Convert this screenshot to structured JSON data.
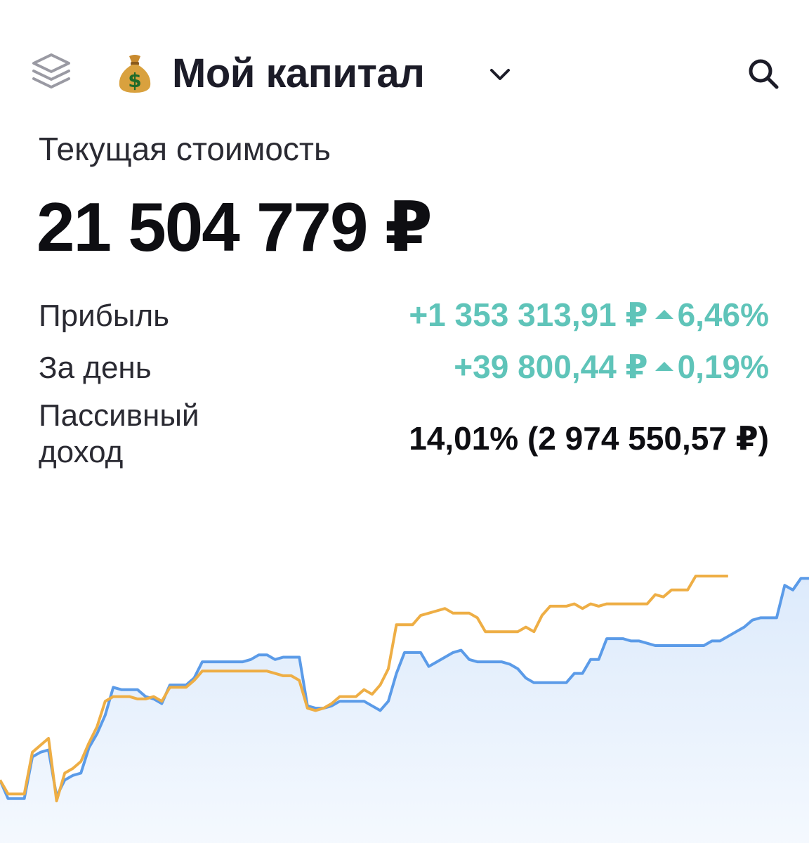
{
  "header": {
    "title": "Мой капитал",
    "layers_icon": "layers-icon",
    "portfolio_icon": "money-bag-icon",
    "dropdown_icon": "chevron-down-icon",
    "search_icon": "search-icon"
  },
  "summary": {
    "current_value_label": "Текущая стоимость",
    "current_value": "21 504 779 ₽",
    "profit_label": "Прибыль",
    "profit_value": "+1 353 313,91 ₽",
    "profit_percent": "6,46%",
    "day_label": "За день",
    "day_value": "+39 800,44 ₽",
    "day_percent": "0,19%",
    "passive_label_line1": "Пассивный",
    "passive_label_line2": "доход",
    "passive_value": "14,01% (2 974 550,57 ₽)"
  },
  "colors": {
    "positive": "#5fc4b9",
    "portfolio_line": "#5b9be8",
    "benchmark_line": "#eeae45",
    "area_fill": "#e4effd"
  },
  "chart_data": {
    "type": "line",
    "title": "",
    "xlabel": "",
    "ylabel": "",
    "grid": false,
    "legend": "none",
    "x": [
      0,
      1,
      2,
      3,
      4,
      5,
      6,
      7,
      8,
      9,
      10,
      11,
      12,
      13,
      14,
      15,
      16,
      17,
      18,
      19,
      20,
      21,
      22,
      23,
      24,
      25,
      26,
      27,
      28,
      29,
      30,
      31,
      32,
      33,
      34,
      35,
      36,
      37,
      38,
      39,
      40,
      41,
      42,
      43,
      44,
      45,
      46,
      47,
      48,
      49,
      50,
      51,
      52,
      53,
      54,
      55,
      56,
      57,
      58,
      59,
      60,
      61,
      62,
      63,
      64,
      65,
      66,
      67,
      68,
      69,
      70,
      71,
      72,
      73,
      74,
      75,
      76,
      77,
      78,
      79,
      80,
      81,
      82,
      83,
      84,
      85,
      86,
      87,
      88,
      89,
      90,
      91,
      92,
      93,
      94,
      95,
      96,
      97,
      98,
      99,
      100
    ],
    "series": [
      {
        "values": [
          12,
          4,
          4,
          4,
          22,
          24,
          25,
          5,
          12,
          14,
          15,
          26,
          32,
          40,
          52,
          51,
          51,
          51,
          48,
          47,
          45,
          53,
          53,
          53,
          56,
          63,
          63,
          63,
          63,
          63,
          63,
          64,
          66,
          66,
          64,
          65,
          65,
          65,
          44,
          43,
          43,
          44,
          46,
          46,
          46,
          46,
          44,
          42,
          46,
          58,
          67,
          67,
          67,
          61,
          63,
          65,
          67,
          68,
          64,
          63,
          63,
          63,
          63,
          62,
          60,
          56,
          54,
          54,
          54,
          54,
          54,
          58,
          58,
          64,
          64,
          73,
          73,
          73,
          72,
          72,
          71,
          70,
          70,
          70,
          70,
          70,
          70,
          70,
          72,
          72,
          74,
          76,
          78,
          81,
          82,
          82,
          82,
          96,
          94,
          99,
          99
        ]
      },
      {
        "values": [
          12,
          6,
          6,
          6,
          24,
          27,
          30,
          3,
          15,
          17,
          20,
          28,
          35,
          46,
          48,
          48,
          48,
          47,
          47,
          48,
          46,
          52,
          52,
          52,
          55,
          59,
          59,
          59,
          59,
          59,
          59,
          59,
          59,
          59,
          58,
          57,
          57,
          55,
          43,
          42,
          43,
          45,
          48,
          48,
          48,
          51,
          49,
          53,
          60,
          79,
          79,
          79,
          83,
          84,
          85,
          86,
          84,
          84,
          84,
          82,
          76,
          76,
          76,
          76,
          76,
          78,
          76,
          83,
          87,
          87,
          87,
          88,
          86,
          88,
          87,
          88,
          88,
          88,
          88,
          88,
          88,
          92,
          91,
          94,
          94,
          94,
          100,
          100,
          100,
          100,
          100
        ]
      }
    ],
    "ylim": [
      0,
      100
    ]
  }
}
